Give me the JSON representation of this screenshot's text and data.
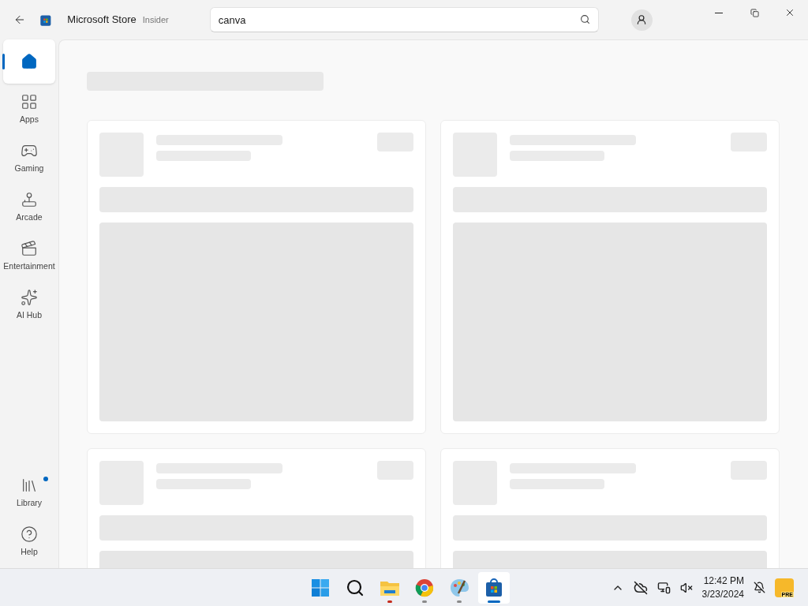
{
  "titlebar": {
    "title": "Microsoft Store",
    "badge": "Insider"
  },
  "search": {
    "value": "canva"
  },
  "sidebar": {
    "items": [
      {
        "kind": "home",
        "selected": true
      },
      {
        "kind": "apps",
        "label": "Apps",
        "selected": false
      },
      {
        "kind": "gaming",
        "label": "Gaming",
        "selected": false
      },
      {
        "kind": "arcade",
        "label": "Arcade",
        "selected": false
      },
      {
        "kind": "entertainment",
        "label": "Entertainment",
        "selected": false
      }
    ],
    "ai": {
      "kind": "ai",
      "label": "AI Hub",
      "selected": false
    },
    "bottom": [
      {
        "kind": "library",
        "label": "Library",
        "selected": false,
        "notification": true
      },
      {
        "kind": "help",
        "label": "Help",
        "selected": false
      }
    ]
  },
  "cards": [
    {
      "kind": "loading"
    },
    {
      "kind": "loading"
    },
    {
      "kind": "loading"
    },
    {
      "kind": "loading"
    }
  ],
  "taskbar": {
    "apps": [
      {
        "kind": "start",
        "selected": false
      },
      {
        "kind": "search",
        "selected": false
      },
      {
        "kind": "files",
        "selected": false,
        "color": "#c42b1c"
      },
      {
        "kind": "browser",
        "selected": false,
        "color": "#8a8a8a"
      },
      {
        "kind": "paint",
        "selected": false,
        "color": "#8a8a8a"
      },
      {
        "kind": "store",
        "selected": true,
        "color": "#0067c0"
      }
    ],
    "time": "12:42 PM",
    "date": "3/23/2024",
    "pre_badge": "PRE"
  }
}
